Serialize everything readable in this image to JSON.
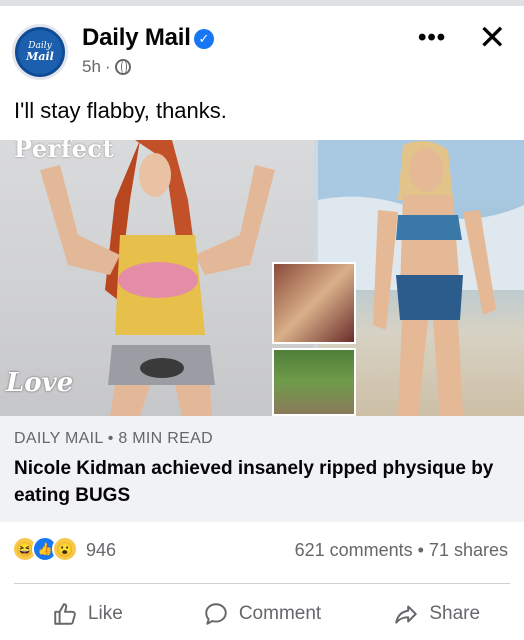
{
  "post": {
    "page_name": "Daily Mail",
    "avatar_text_top": "Daily",
    "avatar_text_bottom": "Mail",
    "time": "5h",
    "separator": "·",
    "caption": "I'll stay flabby, thanks."
  },
  "header_controls": {
    "more": "•••",
    "close": "✕",
    "verified_check": "✓"
  },
  "media": {
    "left_title": "Perfect",
    "left_love": "Love"
  },
  "link": {
    "domain": "DAILY MAIL • 8 MIN READ",
    "headline": "Nicole Kidman achieved insanely ripped physique by eating BUGS"
  },
  "stats": {
    "reaction_count": "946",
    "comments_shares": "621 comments • 71 shares",
    "reactions": [
      "haha",
      "like",
      "wow"
    ]
  },
  "actions": {
    "like": "Like",
    "comment": "Comment",
    "share": "Share"
  }
}
